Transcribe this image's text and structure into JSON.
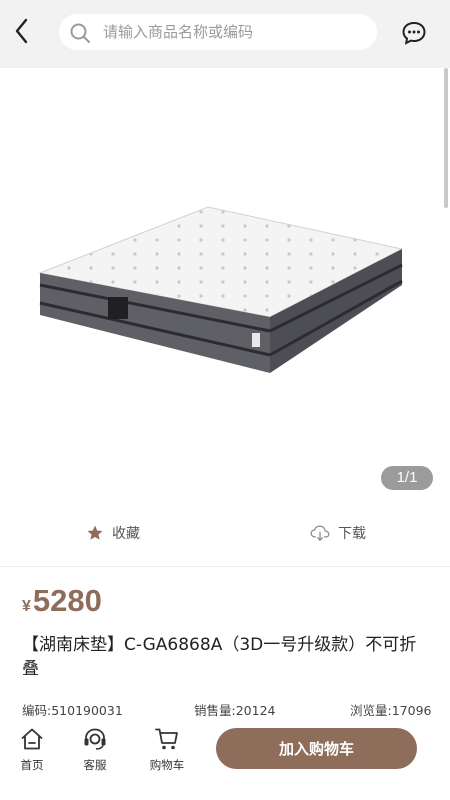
{
  "header": {
    "back_icon": "chevron-left-icon",
    "search_placeholder": "请输入商品名称或编码",
    "message_icon": "chat-bubble-icon"
  },
  "gallery": {
    "page_indicator": "1/1"
  },
  "actions": {
    "favorite_label": "收藏",
    "favorite_icon": "star-icon",
    "download_label": "下载",
    "download_icon": "cloud-download-icon"
  },
  "product": {
    "currency_symbol": "¥",
    "price": "5280",
    "title": "【湖南床垫】C-GA6868A（3D一号升级款）不可折叠",
    "code": "编码:510190031",
    "sales": "销售量:20124",
    "views": "浏览量:17096"
  },
  "tabbar": {
    "home_label": "首页",
    "service_label": "客服",
    "cart_label": "购物车",
    "add_to_cart_label": "加入购物车"
  },
  "colors": {
    "accent": "#8e6d5a",
    "header_bg": "#f2f2f2",
    "indicator_bg": "#9b9b9b"
  }
}
